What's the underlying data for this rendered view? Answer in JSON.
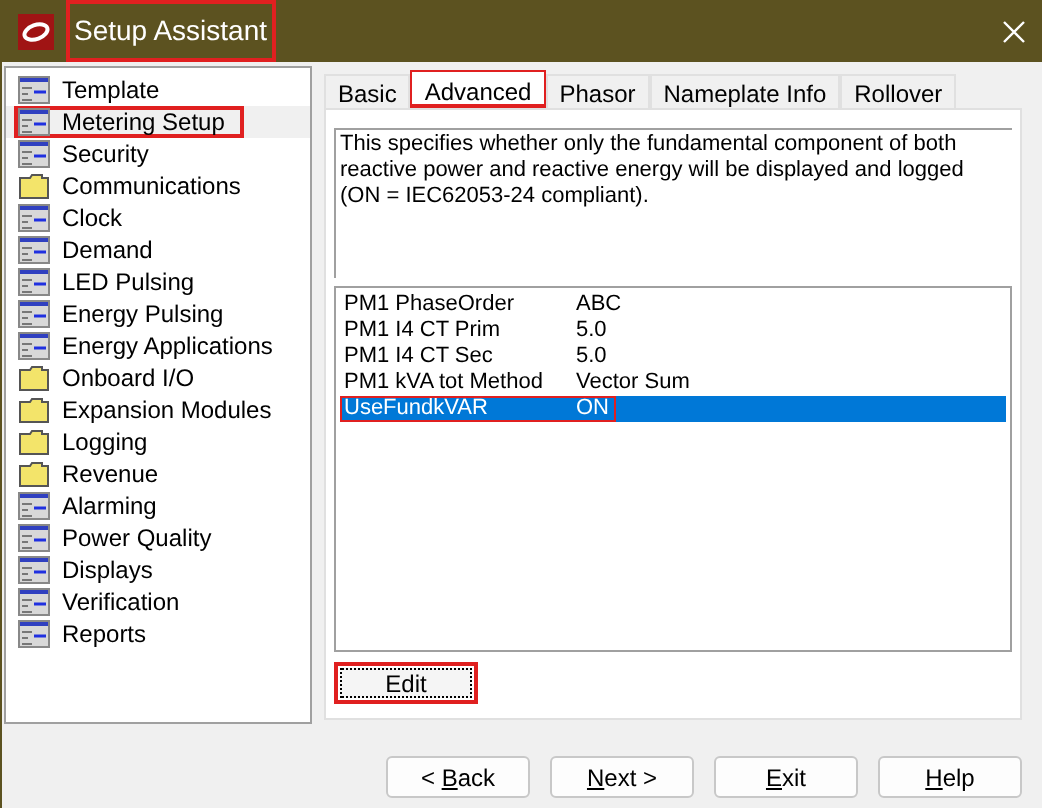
{
  "window": {
    "title": "Setup Assistant",
    "highlighted": true
  },
  "sidebar": {
    "items": [
      {
        "label": "Template",
        "kind": "page",
        "selected": false,
        "highlighted": false
      },
      {
        "label": "Metering Setup",
        "kind": "page",
        "selected": true,
        "highlighted": true
      },
      {
        "label": "Security",
        "kind": "page",
        "selected": false,
        "highlighted": false
      },
      {
        "label": "Communications",
        "kind": "folder",
        "selected": false,
        "highlighted": false
      },
      {
        "label": "Clock",
        "kind": "page",
        "selected": false,
        "highlighted": false
      },
      {
        "label": "Demand",
        "kind": "page",
        "selected": false,
        "highlighted": false
      },
      {
        "label": "LED Pulsing",
        "kind": "page",
        "selected": false,
        "highlighted": false
      },
      {
        "label": "Energy Pulsing",
        "kind": "page",
        "selected": false,
        "highlighted": false
      },
      {
        "label": "Energy Applications",
        "kind": "page",
        "selected": false,
        "highlighted": false
      },
      {
        "label": "Onboard I/O",
        "kind": "folder",
        "selected": false,
        "highlighted": false
      },
      {
        "label": "Expansion Modules",
        "kind": "folder",
        "selected": false,
        "highlighted": false
      },
      {
        "label": "Logging",
        "kind": "folder",
        "selected": false,
        "highlighted": false
      },
      {
        "label": "Revenue",
        "kind": "folder",
        "selected": false,
        "highlighted": false
      },
      {
        "label": "Alarming",
        "kind": "page",
        "selected": false,
        "highlighted": false
      },
      {
        "label": "Power Quality",
        "kind": "page",
        "selected": false,
        "highlighted": false
      },
      {
        "label": "Displays",
        "kind": "page",
        "selected": false,
        "highlighted": false
      },
      {
        "label": "Verification",
        "kind": "page",
        "selected": false,
        "highlighted": false
      },
      {
        "label": "Reports",
        "kind": "page",
        "selected": false,
        "highlighted": false
      }
    ]
  },
  "tabs": [
    {
      "label": "Basic",
      "selected": false,
      "highlighted": false
    },
    {
      "label": "Advanced",
      "selected": true,
      "highlighted": true
    },
    {
      "label": "Phasor",
      "selected": false,
      "highlighted": false
    },
    {
      "label": "Nameplate Info",
      "selected": false,
      "highlighted": false
    },
    {
      "label": "Rollover",
      "selected": false,
      "highlighted": false
    }
  ],
  "description": "This specifies whether only the fundamental component of both reactive power and reactive energy will be displayed and logged (ON = IEC62053-24 compliant).",
  "settings": [
    {
      "name": "PM1 PhaseOrder",
      "value": "ABC",
      "selected": false,
      "highlighted": false
    },
    {
      "name": "PM1 I4 CT Prim",
      "value": "5.0",
      "selected": false,
      "highlighted": false
    },
    {
      "name": "PM1 I4 CT Sec",
      "value": "5.0",
      "selected": false,
      "highlighted": false
    },
    {
      "name": "PM1 kVA tot Method",
      "value": "Vector Sum",
      "selected": false,
      "highlighted": false
    },
    {
      "name": "UseFundkVAR",
      "value": "ON",
      "selected": true,
      "highlighted": true
    }
  ],
  "edit_button": {
    "label": "Edit",
    "highlighted": true
  },
  "buttons": [
    {
      "before": "< ",
      "key": "B",
      "after": "ack"
    },
    {
      "key": "N",
      "after": "ext >"
    },
    {
      "key": "E",
      "after": "xit"
    },
    {
      "key": "H",
      "after": "elp"
    }
  ]
}
